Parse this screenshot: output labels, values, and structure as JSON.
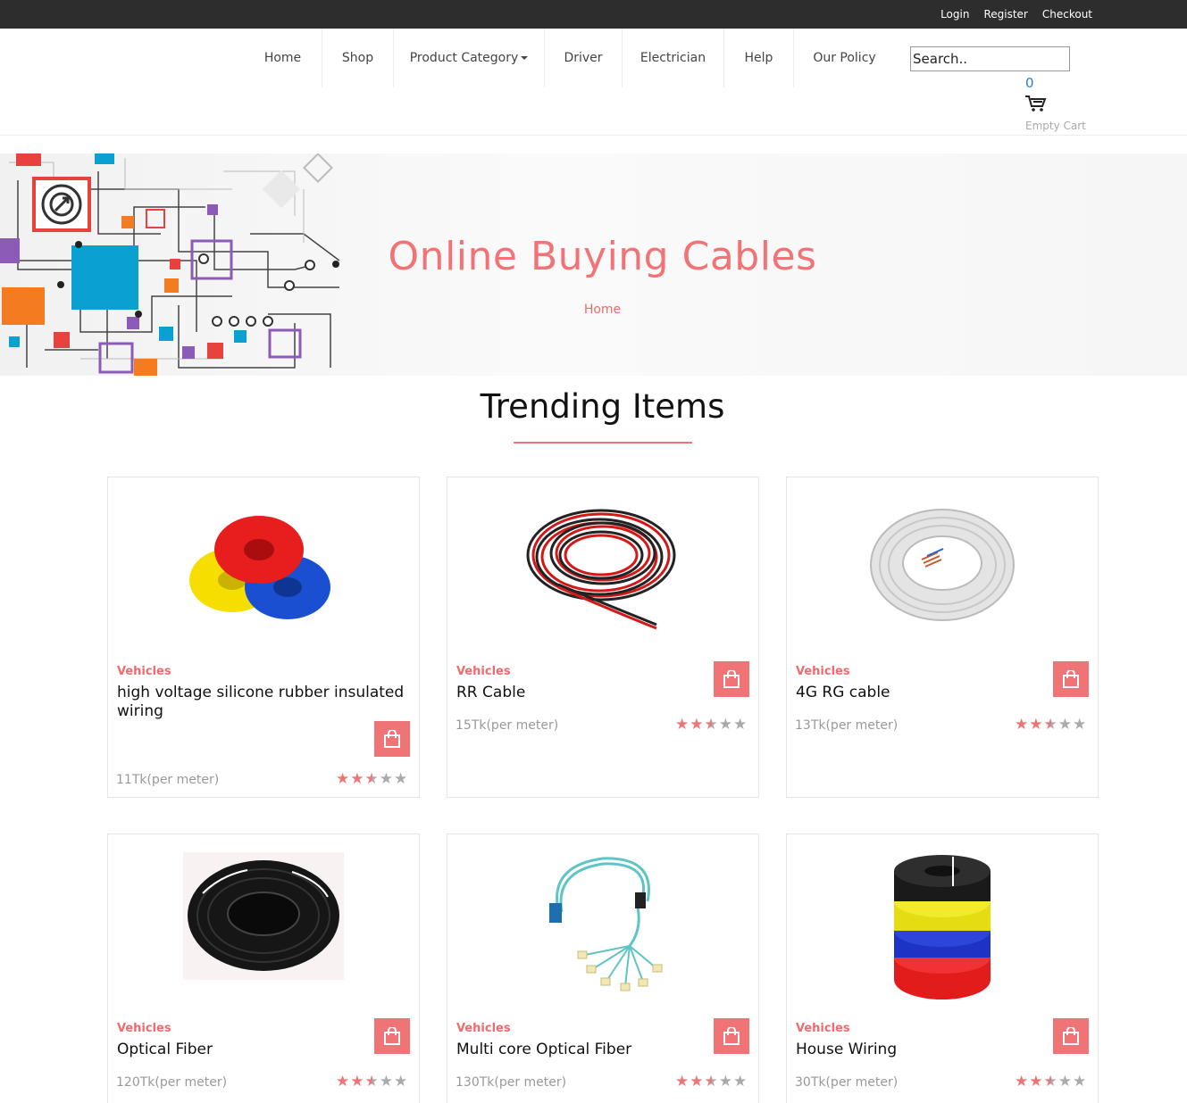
{
  "topbar": {
    "login": "Login",
    "register": "Register",
    "checkout": "Checkout"
  },
  "nav": {
    "items": [
      {
        "label": "Home"
      },
      {
        "label": "Shop"
      },
      {
        "label": "Product Category",
        "dropdown": true
      },
      {
        "label": "Driver"
      },
      {
        "label": "Electrician"
      },
      {
        "label": "Help"
      },
      {
        "label": "Our Policy"
      }
    ],
    "search_value": "Search..",
    "cart_count": "0",
    "cart_status": "Empty Cart"
  },
  "hero": {
    "title": "Online Buying Cables",
    "breadcrumb": "Home"
  },
  "section": {
    "title": "Trending Items"
  },
  "colors": {
    "accent": "#f07376",
    "topbar": "#2d2d2d",
    "star_off": "#aaaaaa"
  },
  "products": [
    {
      "category": "Vehicles",
      "name": "high voltage silicone rubber insulated wiring",
      "price": "11Tk(per meter)",
      "rating": 2.5,
      "image": "rgb-cable-coils"
    },
    {
      "category": "Vehicles",
      "name": "RR Cable",
      "price": "15Tk(per meter)",
      "rating": 2.5,
      "image": "red-black-cable-coil"
    },
    {
      "category": "Vehicles",
      "name": "4G RG cable",
      "price": "13Tk(per meter)",
      "rating": 2.5,
      "image": "grey-cable-coil"
    },
    {
      "category": "Vehicles",
      "name": "Optical Fiber",
      "price": "120Tk(per meter)",
      "rating": 2.5,
      "image": "black-cable-coil"
    },
    {
      "category": "Vehicles",
      "name": "Multi core Optical Fiber",
      "price": "130Tk(per meter)",
      "rating": 2.5,
      "image": "fiber-patch-cord"
    },
    {
      "category": "Vehicles",
      "name": "House Wiring",
      "price": "30Tk(per meter)",
      "rating": 2.5,
      "image": "stacked-wire-coils"
    }
  ]
}
